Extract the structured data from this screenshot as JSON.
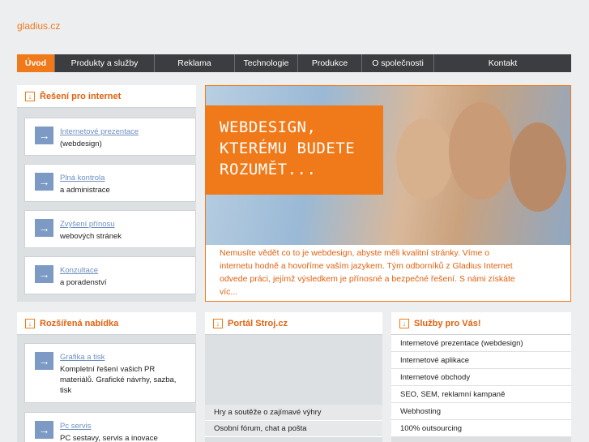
{
  "site": {
    "logo": "gladius.cz"
  },
  "nav": [
    {
      "label": "Úvod"
    },
    {
      "label": "Produkty a služby"
    },
    {
      "label": "Reklama"
    },
    {
      "label": "Technologie"
    },
    {
      "label": "Produkce"
    },
    {
      "label": "O společnosti"
    },
    {
      "label": "Kontakt"
    }
  ],
  "internet_panel": {
    "title": "Řešení pro internet",
    "items": [
      {
        "link": "Internetové prezentace",
        "desc": "(webdesign)"
      },
      {
        "link": "Plná kontrola",
        "desc": "a administrace"
      },
      {
        "link": "Zvýšení přínosu",
        "desc": "webových stránek"
      },
      {
        "link": "Konzultace",
        "desc": "a poradenství"
      }
    ]
  },
  "hero": {
    "headline": [
      "WEBDESIGN,",
      "KTERÉMU BUDETE",
      "ROZUMĚT..."
    ],
    "text": "Nemusíte vědět co to je webdesign, abyste měli kvalitní stránky. Víme o internetu hodně a hovoříme vaším jazykem. Tým odborníků z Gladius Internet odvede práci, jejímž výsledkem je přínosné a bezpečné řešení. S námi získáte víc..."
  },
  "extended_panel": {
    "title": "Rozšířená nabídka",
    "items": [
      {
        "link": "Grafika a tisk",
        "desc": "Kompletní řešení vašich PR materiálů. Grafické návrhy, sazba, tisk"
      },
      {
        "link": "Pc servis",
        "desc": "PC sestavy, servis a inovace"
      }
    ]
  },
  "portal_panel": {
    "title": "Portál Stroj.cz",
    "items": [
      "Hry a soutěže o zajímavé výhry",
      "Osobní fórum, chat a pošta"
    ]
  },
  "services_panel": {
    "title": "Služby pro Vás!",
    "items": [
      "Internetové prezentace (webdesign)",
      "Internetové aplikace",
      "Internetové obchody",
      "SEO, SEM, reklamní kampaně",
      "Webhosting",
      "100% outsourcing"
    ]
  },
  "colors": {
    "accent": "#f07a1a",
    "nav_bg": "#3b3d40",
    "link": "#6d8fc0"
  }
}
